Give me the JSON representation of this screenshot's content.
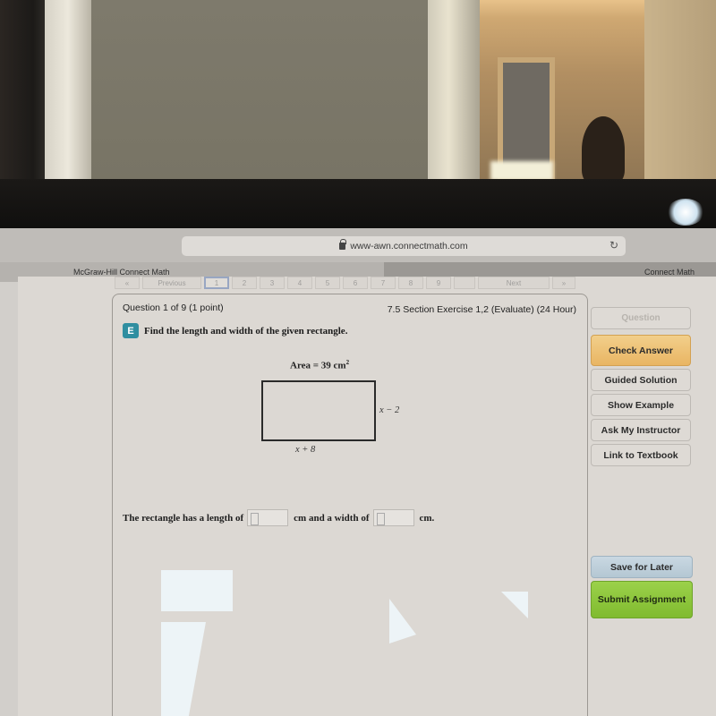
{
  "browser": {
    "url": "www-awn.connectmath.com",
    "lock_icon": "lock-icon",
    "reload_icon": "reload-icon",
    "tabs": [
      {
        "label": "McGraw-Hill Connect Math",
        "active": true
      },
      {
        "label": "Connect Math",
        "active": false
      }
    ]
  },
  "question_nav": {
    "first_label": "«",
    "previous_label": "Previous",
    "numbers": [
      "1",
      "2",
      "3",
      "4",
      "5",
      "6",
      "7",
      "8",
      "9"
    ],
    "selected": "1",
    "next_label": "Next",
    "last_label": "»"
  },
  "question": {
    "header": "Question 1 of 9 (1 point)",
    "section": "7.5 Section Exercise 1,2 (Evaluate) (24 Hour)",
    "badge": "E",
    "prompt": "Find the length and width of the given rectangle.",
    "figure": {
      "area_text": "Area = 39 cm",
      "area_exponent": "2",
      "side_label": "x − 2",
      "bottom_label": "x + 8"
    },
    "answer": {
      "text_before_length": "The rectangle has a length of",
      "length_value": "",
      "text_between": "cm and a width of",
      "width_value": "",
      "text_after": "cm."
    }
  },
  "tools": {
    "question_label": "Question",
    "check_answer": "Check Answer",
    "guided_solution": "Guided Solution",
    "show_example": "Show Example",
    "ask_instructor": "Ask My Instructor",
    "link_textbook": "Link to Textbook",
    "save_later": "Save for Later",
    "submit_assignment": "Submit Assignment"
  },
  "colors": {
    "check_answer": "#e9b563",
    "submit": "#80bb2f",
    "save": "#b4c7d3",
    "badge": "#2f8ea0"
  }
}
